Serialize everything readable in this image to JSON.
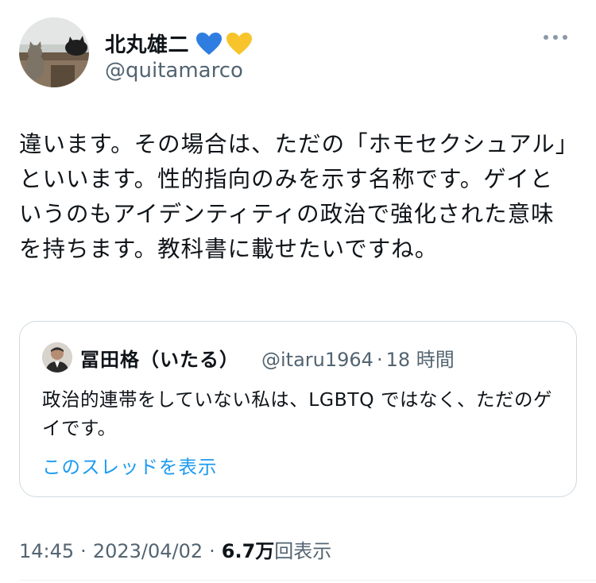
{
  "author": {
    "name": "北丸雄二",
    "handle": "@quitamarco",
    "hearts": [
      "blue-heart-emoji",
      "yellow-heart-emoji"
    ],
    "colors": {
      "blue_heart": "#2f7de1",
      "yellow_heart": "#f7c52b"
    }
  },
  "tweet": {
    "text": "違います。その場合は、ただの「ホモセクシュアル」といいます。性的指向のみを示す名称です。ゲイというのもアイデンティティの政治で強化された意味を持ちます。教科書に載せたいですね。"
  },
  "quote": {
    "name": "冨田格（いたる）",
    "handle": "@itaru1964",
    "separator": "·",
    "time": "18 時間",
    "text": "政治的連帯をしていない私は、LGBTQ ではなく、ただのゲイです。",
    "link": "このスレッドを表示"
  },
  "meta": {
    "time": "14:45",
    "separator": "·",
    "date": "2023/04/02",
    "views_count": "6.7万",
    "views_label": "回表示"
  },
  "colors": {
    "link": "#1d9bf0",
    "secondary": "#536471",
    "border": "#cfd9de"
  }
}
